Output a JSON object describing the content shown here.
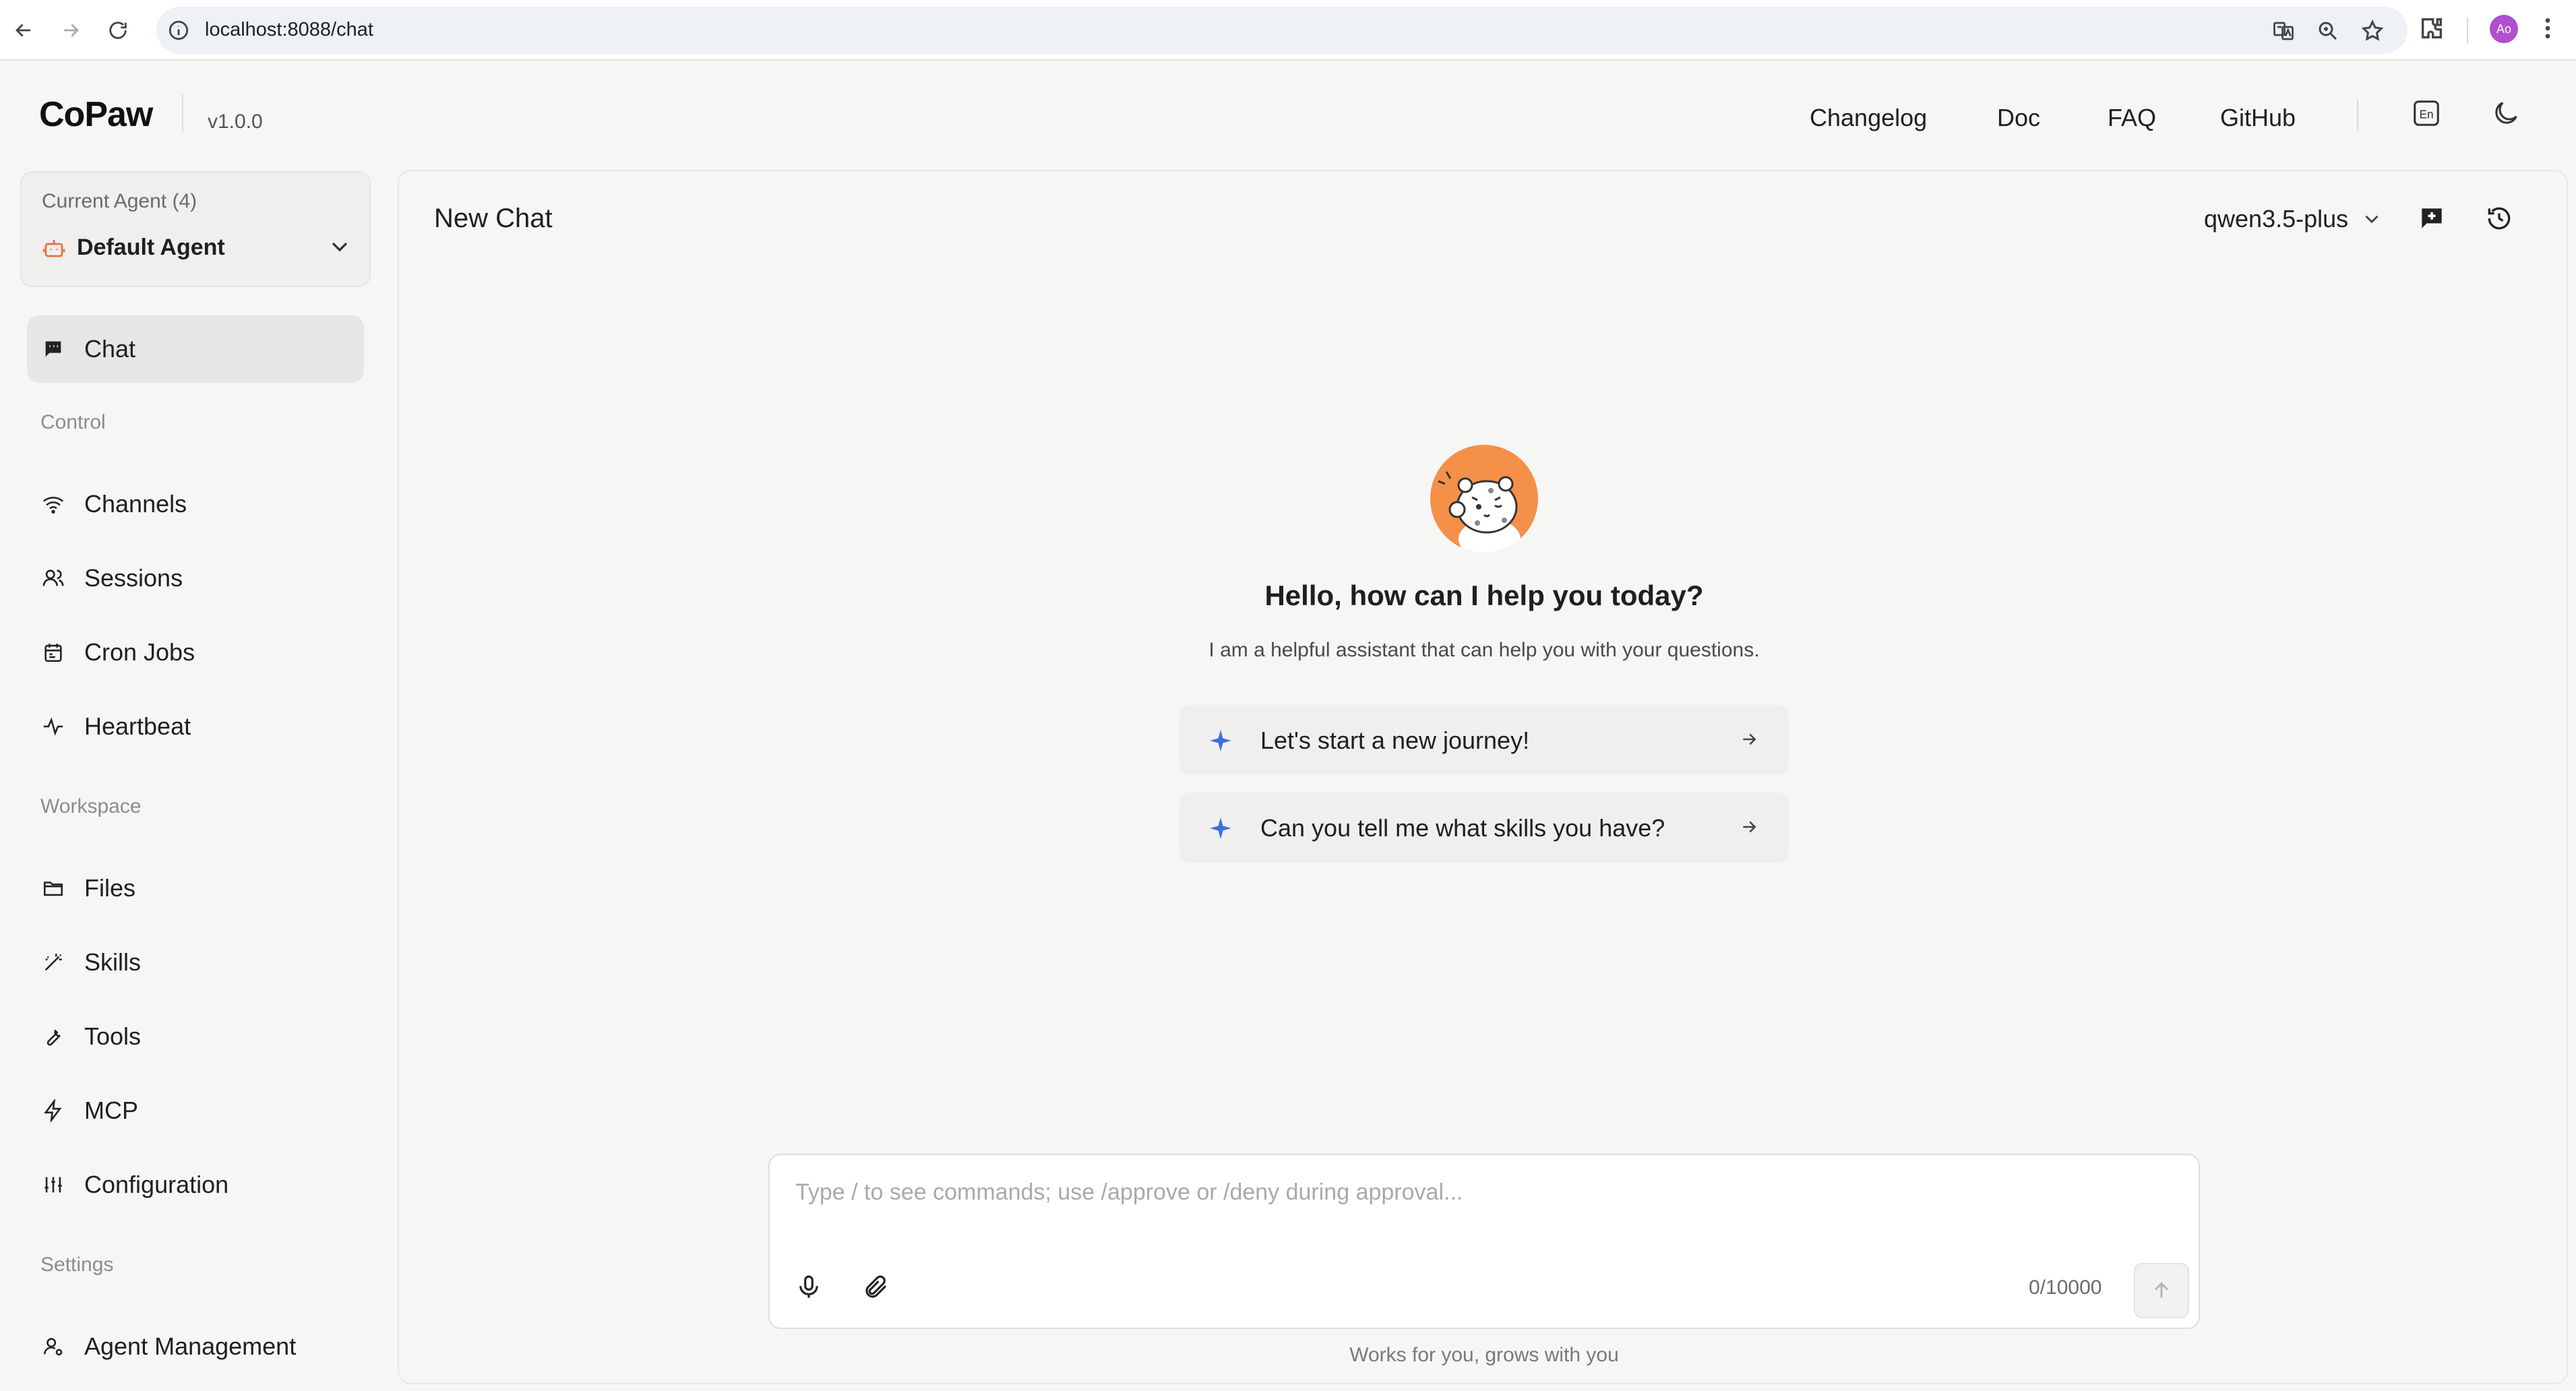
{
  "browser": {
    "url": "localhost:8088/chat",
    "profile_initials": "Ao"
  },
  "header": {
    "logo": "CoPaw",
    "version": "v1.0.0",
    "links": [
      "Changelog",
      "Doc",
      "FAQ",
      "GitHub"
    ],
    "language_icon_text": "En"
  },
  "agent": {
    "label": "Current Agent (4)",
    "name": "Default Agent"
  },
  "sidebar": {
    "chat": "Chat",
    "sections": {
      "control": "Control",
      "workspace": "Workspace",
      "settings": "Settings"
    },
    "control_items": [
      "Channels",
      "Sessions",
      "Cron Jobs",
      "Heartbeat"
    ],
    "workspace_items": [
      "Files",
      "Skills",
      "Tools",
      "MCP",
      "Configuration"
    ],
    "settings_items": [
      "Agent Management"
    ]
  },
  "chat": {
    "title": "New Chat",
    "model": "qwen3.5-plus",
    "welcome_title": "Hello, how can I help you today?",
    "welcome_subtitle": "I am a helpful assistant that can help you with your questions.",
    "prompts": [
      "Let's start a new journey!",
      "Can you tell me what skills you have?"
    ],
    "input_placeholder": "Type / to see commands; use /approve or /deny during approval...",
    "char_count": "0/10000",
    "footer": "Works for you, grows with you"
  },
  "colors": {
    "accent_orange": "#f59049",
    "sparkle_blue": "#3b6fe0",
    "active_bg": "#e6e6e4"
  }
}
